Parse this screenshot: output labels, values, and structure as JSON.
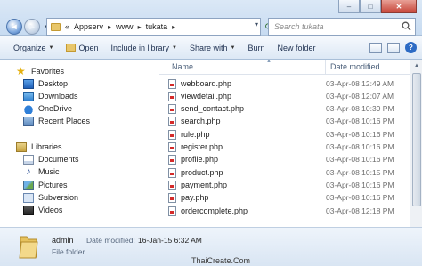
{
  "window": {
    "minimize_glyph": "–",
    "maximize_glyph": "□",
    "close_glyph": "✕"
  },
  "address": {
    "crumbs": [
      "Appserv",
      "www",
      "tukata"
    ],
    "separator": "▸",
    "prefix": "«"
  },
  "search": {
    "placeholder": "Search tukata"
  },
  "toolbar": {
    "organize": "Organize",
    "open": "Open",
    "include_in_library": "Include in library",
    "share_with": "Share with",
    "burn": "Burn",
    "new_folder": "New folder",
    "help": "?"
  },
  "nav": {
    "favorites": "Favorites",
    "desktop": "Desktop",
    "downloads": "Downloads",
    "onedrive": "OneDrive",
    "recent_places": "Recent Places",
    "libraries": "Libraries",
    "documents": "Documents",
    "music": "Music",
    "pictures": "Pictures",
    "subversion": "Subversion",
    "videos": "Videos"
  },
  "files": {
    "col_name": "Name",
    "col_date": "Date modified",
    "rows": [
      {
        "name": "webboard.php",
        "date": "03-Apr-08 12:49 AM"
      },
      {
        "name": "viewdetail.php",
        "date": "03-Apr-08 12:07 AM"
      },
      {
        "name": "send_contact.php",
        "date": "03-Apr-08 10:39 PM"
      },
      {
        "name": "search.php",
        "date": "03-Apr-08 10:16 PM"
      },
      {
        "name": "rule.php",
        "date": "03-Apr-08 10:16 PM"
      },
      {
        "name": "register.php",
        "date": "03-Apr-08 10:16 PM"
      },
      {
        "name": "profile.php",
        "date": "03-Apr-08 10:16 PM"
      },
      {
        "name": "product.php",
        "date": "03-Apr-08 10:15 PM"
      },
      {
        "name": "payment.php",
        "date": "03-Apr-08 10:16 PM"
      },
      {
        "name": "pay.php",
        "date": "03-Apr-08 10:16 PM"
      },
      {
        "name": "ordercomplete.php",
        "date": "03-Apr-08 12:18 PM"
      }
    ]
  },
  "details": {
    "name": "admin",
    "type": "File folder",
    "modified_label": "Date modified:",
    "modified_value": "16-Jan-15 6:32 AM"
  },
  "watermark": "ThaiCreate.Com"
}
